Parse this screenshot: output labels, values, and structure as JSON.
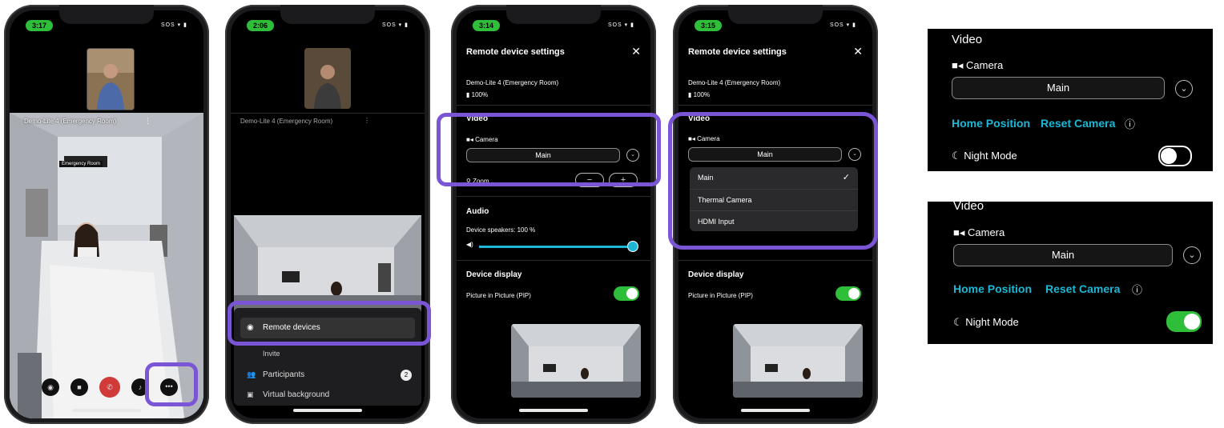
{
  "phone1": {
    "time": "3:17",
    "status": "SOS",
    "device_label": "Demo-Lite 4 (Emergency Room)",
    "room_sign": "Emergency Room"
  },
  "phone2": {
    "time": "2:06",
    "status": "SOS",
    "device_label": "Demo-Lite 4 (Emergency Room)",
    "menu": {
      "remote_devices": "Remote devices",
      "invite": "Invite",
      "participants": "Participants",
      "participants_count": "2",
      "virtual_background": "Virtual background"
    }
  },
  "phone3": {
    "time": "3:14",
    "status": "SOS",
    "title": "Remote device settings",
    "device_name": "Demo-Lite 4 (Emergency Room)",
    "battery": "100%",
    "video_heading": "Video",
    "camera_label": "Camera",
    "camera_value": "Main",
    "zoom_label": "Zoom",
    "zoom_minus": "−",
    "zoom_plus": "+",
    "audio_heading": "Audio",
    "speakers_label": "Device speakers:  100 %",
    "speakers_level": 1.0,
    "display_heading": "Device display",
    "pip_label": "Picture in Picture (PIP)",
    "pip_on": true
  },
  "phone4": {
    "time": "3:15",
    "status": "SOS",
    "title": "Remote device settings",
    "device_name": "Demo-Lite 4 (Emergency Room)",
    "battery": "100%",
    "video_heading": "Video",
    "camera_label": "Camera",
    "camera_value": "Main",
    "dropdown_options": [
      "Main",
      "Thermal Camera",
      "HDMI Input"
    ],
    "selected_option": "Main",
    "display_heading": "Device display",
    "pip_label": "Picture in Picture (PIP)",
    "pip_on": true
  },
  "zoom_panel_top": {
    "heading": "Video",
    "camera_label": "Camera",
    "camera_value": "Main",
    "home_position": "Home Position",
    "reset_camera": "Reset Camera",
    "night_mode_label": "Night Mode",
    "night_mode_on": false
  },
  "zoom_panel_bottom": {
    "heading": "Video",
    "camera_label": "Camera",
    "camera_value": "Main",
    "home_position": "Home Position",
    "reset_camera": "Reset Camera",
    "night_mode_label": "Night Mode",
    "night_mode_on": true
  },
  "colors": {
    "highlight": "#7a55d6",
    "accent_cyan": "#1fb7d6",
    "toggle_green": "#2fbe3a",
    "end_call_red": "#d23a3a"
  }
}
